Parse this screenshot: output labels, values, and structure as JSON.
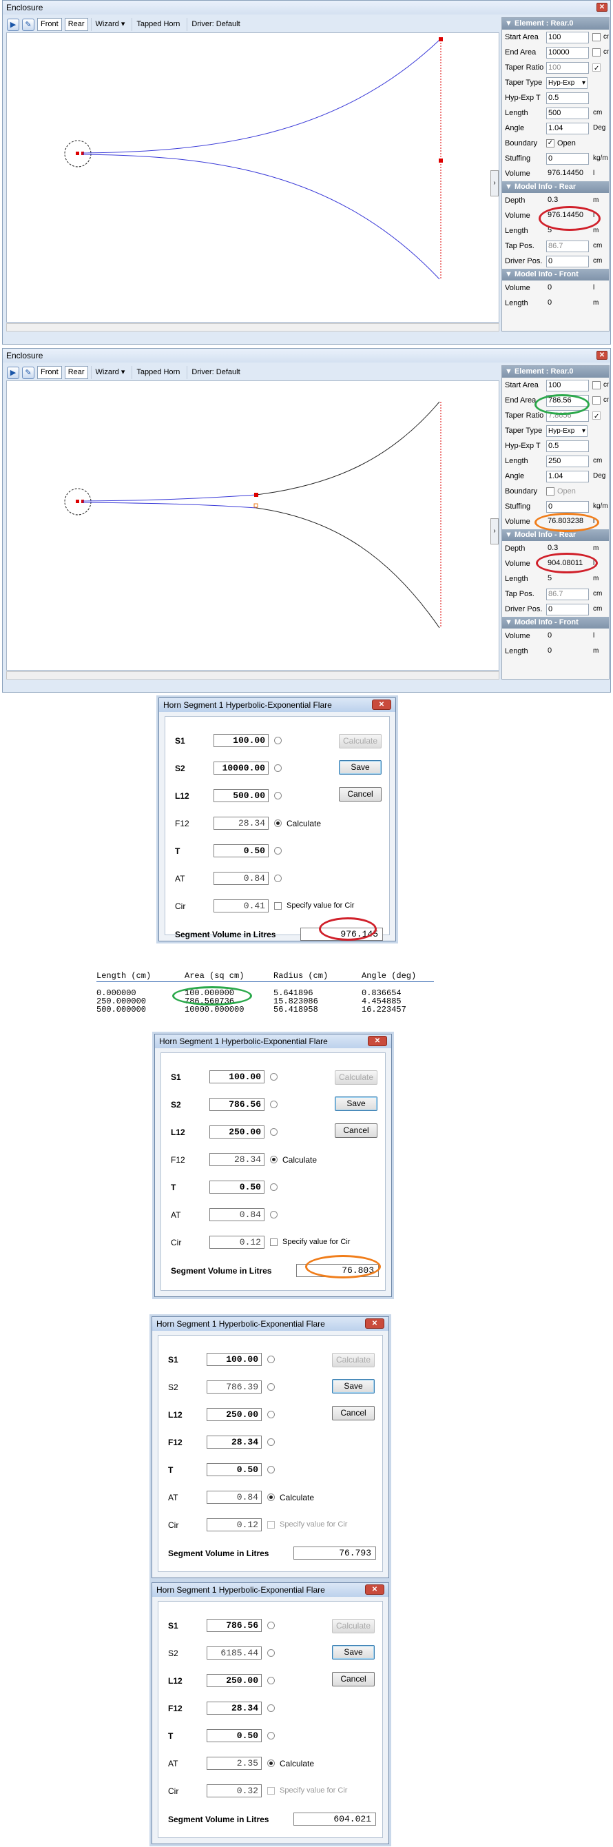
{
  "window1": {
    "title": "Enclosure",
    "toolbar": {
      "front": "Front",
      "rear": "Rear",
      "wizard": "Wizard",
      "tapped": "Tapped Horn",
      "driver": "Driver: Default"
    },
    "panel": {
      "element_header": "Element : Rear.0",
      "rows": [
        {
          "label": "Start Area",
          "value": "100",
          "unit": "cm²",
          "check": false
        },
        {
          "label": "End Area",
          "value": "10000",
          "unit": "cm²",
          "check": false
        },
        {
          "label": "Taper Ratio",
          "value": "100",
          "check": true,
          "disabled": true
        },
        {
          "label": "Taper Type",
          "value": "Hyp-Exp"
        },
        {
          "label": "Hyp-Exp T",
          "value": "0.5"
        },
        {
          "label": "Length",
          "value": "500",
          "unit": "cm"
        },
        {
          "label": "Angle",
          "value": "1.04",
          "unit": "Deg"
        },
        {
          "label": "Boundary",
          "value": "Open",
          "check": true
        },
        {
          "label": "Stuffing",
          "value": "0",
          "unit": "kg/m"
        },
        {
          "label": "Volume",
          "value": "976.14450",
          "unit": "l"
        }
      ],
      "model_rear_header": "Model Info - Rear",
      "rear_rows": [
        {
          "label": "Depth",
          "value": "0.3",
          "unit": "m"
        },
        {
          "label": "Volume",
          "value": "976.14450",
          "unit": "l"
        },
        {
          "label": "Length",
          "value": "5",
          "unit": "m"
        },
        {
          "label": "Tap Pos.",
          "value": "86.7",
          "unit": "cm"
        },
        {
          "label": "Driver Pos.",
          "value": "0",
          "unit": "cm"
        }
      ],
      "model_front_header": "Model Info - Front",
      "front_rows": [
        {
          "label": "Volume",
          "value": "0",
          "unit": "l"
        },
        {
          "label": "Length",
          "value": "0",
          "unit": "m"
        }
      ]
    }
  },
  "window2": {
    "title": "Enclosure",
    "toolbar": {
      "front": "Front",
      "rear": "Rear",
      "wizard": "Wizard",
      "tapped": "Tapped Horn",
      "driver": "Driver: Default"
    },
    "panel": {
      "element_header": "Element : Rear.0",
      "rows": [
        {
          "label": "Start Area",
          "value": "100",
          "unit": "cm²",
          "check": false
        },
        {
          "label": "End Area",
          "value": "786.56",
          "unit": "cm²",
          "check": false
        },
        {
          "label": "Taper Ratio",
          "value": "7.8656",
          "check": true,
          "disabled": true
        },
        {
          "label": "Taper Type",
          "value": "Hyp-Exp"
        },
        {
          "label": "Hyp-Exp T",
          "value": "0.5"
        },
        {
          "label": "Length",
          "value": "250",
          "unit": "cm"
        },
        {
          "label": "Angle",
          "value": "1.04",
          "unit": "Deg"
        },
        {
          "label": "Boundary",
          "value": "Open",
          "check": false
        },
        {
          "label": "Stuffing",
          "value": "0",
          "unit": "kg/m"
        },
        {
          "label": "Volume",
          "value": "76.803238",
          "unit": "l"
        }
      ],
      "model_rear_header": "Model Info - Rear",
      "rear_rows": [
        {
          "label": "Depth",
          "value": "0.3",
          "unit": "m"
        },
        {
          "label": "Volume",
          "value": "904.08011",
          "unit": "l"
        },
        {
          "label": "Length",
          "value": "5",
          "unit": "m"
        },
        {
          "label": "Tap Pos.",
          "value": "86.7",
          "unit": "cm"
        },
        {
          "label": "Driver Pos.",
          "value": "0",
          "unit": "cm"
        }
      ],
      "model_front_header": "Model Info - Front",
      "front_rows": [
        {
          "label": "Volume",
          "value": "0",
          "unit": "l"
        },
        {
          "label": "Length",
          "value": "0",
          "unit": "m"
        }
      ]
    }
  },
  "dialogs": [
    {
      "title": "Horn Segment 1 Hyperbolic-Exponential Flare",
      "fields": [
        {
          "label": "S1",
          "value": "100.00",
          "bold": true,
          "radio": false
        },
        {
          "label": "S2",
          "value": "10000.00",
          "bold": true,
          "radio": false
        },
        {
          "label": "L12",
          "value": "500.00",
          "bold": true,
          "radio": false
        },
        {
          "label": "F12",
          "value": "28.34",
          "bold": false,
          "radio": true,
          "radio_label": "Calculate"
        },
        {
          "label": "T",
          "value": "0.50",
          "bold": true,
          "radio": false
        },
        {
          "label": "AT",
          "value": "0.84",
          "bold": false,
          "radio": false
        },
        {
          "label": "Cir",
          "value": "0.41",
          "bold": false,
          "check_label": "Specify value for Cir",
          "check_disabled": false
        }
      ],
      "buttons": {
        "calculate": "Calculate",
        "save": "Save",
        "cancel": "Cancel"
      },
      "segment_label": "Segment Volume in Litres",
      "segment_value": "976.145"
    },
    {
      "title": "Horn Segment 1 Hyperbolic-Exponential Flare",
      "fields": [
        {
          "label": "S1",
          "value": "100.00",
          "bold": true,
          "radio": false
        },
        {
          "label": "S2",
          "value": "786.56",
          "bold": true,
          "radio": false
        },
        {
          "label": "L12",
          "value": "250.00",
          "bold": true,
          "radio": false
        },
        {
          "label": "F12",
          "value": "28.34",
          "bold": false,
          "radio": true,
          "radio_label": "Calculate"
        },
        {
          "label": "T",
          "value": "0.50",
          "bold": true,
          "radio": false
        },
        {
          "label": "AT",
          "value": "0.84",
          "bold": false,
          "radio": false
        },
        {
          "label": "Cir",
          "value": "0.12",
          "bold": false,
          "check_label": "Specify value for Cir",
          "check_disabled": false
        }
      ],
      "buttons": {
        "calculate": "Calculate",
        "save": "Save",
        "cancel": "Cancel"
      },
      "segment_label": "Segment Volume in Litres",
      "segment_value": "76.803"
    },
    {
      "title": "Horn Segment 1 Hyperbolic-Exponential Flare",
      "fields": [
        {
          "label": "S1",
          "value": "100.00",
          "bold": true,
          "radio": false
        },
        {
          "label": "S2",
          "value": "786.39",
          "bold": false,
          "radio": false
        },
        {
          "label": "L12",
          "value": "250.00",
          "bold": true,
          "radio": false
        },
        {
          "label": "F12",
          "value": "28.34",
          "bold": true,
          "radio": false
        },
        {
          "label": "T",
          "value": "0.50",
          "bold": true,
          "radio": false
        },
        {
          "label": "AT",
          "value": "0.84",
          "bold": false,
          "radio": true,
          "radio_label": "Calculate"
        },
        {
          "label": "Cir",
          "value": "0.12",
          "bold": false,
          "check_label": "Specify value for Cir",
          "check_disabled": true
        }
      ],
      "buttons": {
        "calculate": "Calculate",
        "save": "Save",
        "cancel": "Cancel"
      },
      "segment_label": "Segment Volume in Litres",
      "segment_value": "76.793"
    },
    {
      "title": "Horn Segment 1 Hyperbolic-Exponential Flare",
      "fields": [
        {
          "label": "S1",
          "value": "786.56",
          "bold": true,
          "radio": false
        },
        {
          "label": "S2",
          "value": "6185.44",
          "bold": false,
          "radio": false
        },
        {
          "label": "L12",
          "value": "250.00",
          "bold": true,
          "radio": false
        },
        {
          "label": "F12",
          "value": "28.34",
          "bold": true,
          "radio": false
        },
        {
          "label": "T",
          "value": "0.50",
          "bold": true,
          "radio": false
        },
        {
          "label": "AT",
          "value": "2.35",
          "bold": false,
          "radio": true,
          "radio_label": "Calculate"
        },
        {
          "label": "Cir",
          "value": "0.32",
          "bold": false,
          "check_label": "Specify value for Cir",
          "check_disabled": true
        }
      ],
      "buttons": {
        "calculate": "Calculate",
        "save": "Save",
        "cancel": "Cancel"
      },
      "segment_label": "Segment Volume in Litres",
      "segment_value": "604.021"
    }
  ],
  "table": {
    "headers": [
      "Length (cm)",
      "Area (sq cm)",
      "Radius (cm)",
      "Angle (deg)"
    ],
    "rows": [
      [
        "0.000000",
        "100.000000",
        "5.641896",
        "0.836654"
      ],
      [
        "250.000000",
        "786.560736",
        "15.823086",
        "4.454885"
      ],
      [
        "500.000000",
        "10000.000000",
        "56.418958",
        "16.223457"
      ]
    ]
  },
  "colors": {
    "red_ring": "#d0202a",
    "green_ring": "#2aa84a",
    "orange_ring": "#f07d1a",
    "horn_line": "#3a3ad8"
  }
}
